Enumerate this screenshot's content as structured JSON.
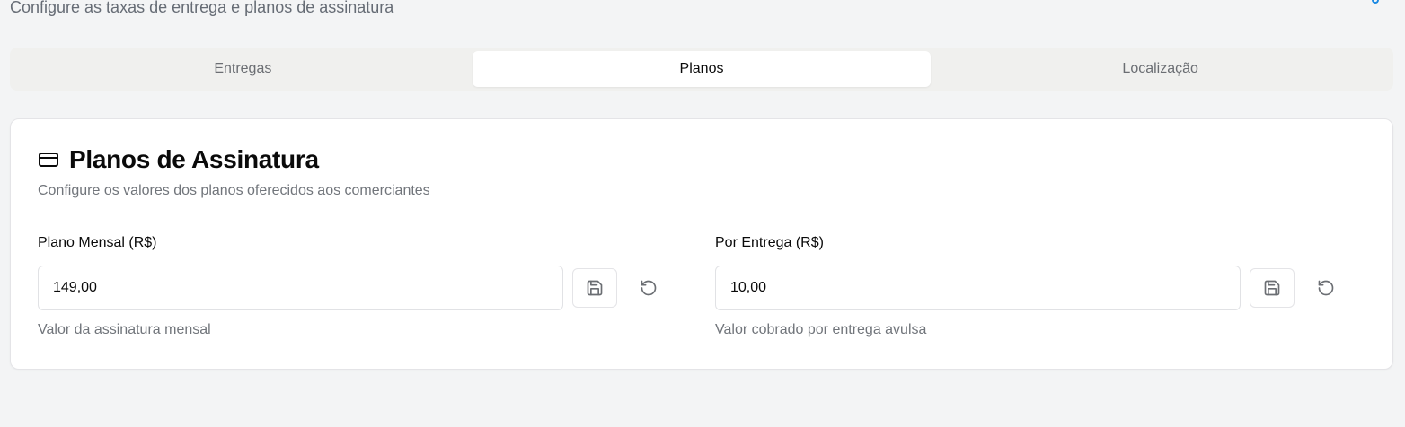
{
  "header": {
    "subtitle": "Configure as taxas de entrega e planos de assinatura"
  },
  "tabs": [
    {
      "label": "Entregas",
      "active": false
    },
    {
      "label": "Planos",
      "active": true
    },
    {
      "label": "Localização",
      "active": false
    }
  ],
  "plans_card": {
    "icon": "credit-card-icon",
    "title": "Planos de Assinatura",
    "description": "Configure os valores dos planos oferecidos aos comerciantes",
    "fields": [
      {
        "label": "Plano Mensal (R$)",
        "value": "149,00",
        "help": "Valor da assinatura mensal",
        "save_icon": "save-icon",
        "reset_icon": "reset-icon"
      },
      {
        "label": "Por Entrega (R$)",
        "value": "10,00",
        "help": "Valor cobrado por entrega avulsa",
        "save_icon": "save-icon",
        "reset_icon": "reset-icon"
      }
    ]
  },
  "colors": {
    "background": "#f3f4f5",
    "card": "#ffffff",
    "muted_text": "#71757b",
    "tab_bar": "#f0f0ee",
    "accent": "#1d8ae3"
  }
}
